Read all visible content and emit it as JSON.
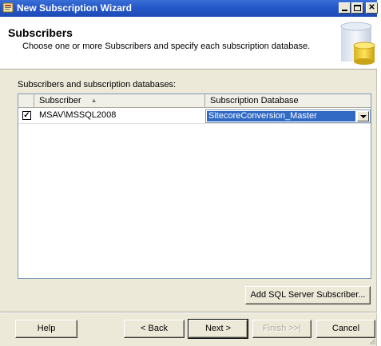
{
  "window": {
    "title": "New Subscription Wizard"
  },
  "header": {
    "title": "Subscribers",
    "subtitle": "Choose one or more Subscribers and specify each subscription database."
  },
  "section_label": "Subscribers and subscription databases:",
  "grid": {
    "columns": [
      "",
      "Subscriber",
      "Subscription Database"
    ],
    "rows": [
      {
        "checked": true,
        "check_glyph": "✓",
        "subscriber": "MSAV\\MSSQL2008",
        "database": "SitecoreConversion_Master"
      }
    ]
  },
  "buttons": {
    "add_subscriber": "Add SQL Server Subscriber...",
    "help": "Help",
    "back": "< Back",
    "next": "Next >",
    "finish": "Finish >>|",
    "cancel": "Cancel"
  },
  "icons": {
    "app": "wizard-app-icon",
    "header_graphic": "database-cylinder-icon",
    "sort": "sort-ascending-icon",
    "dropdown": "chevron-down-icon"
  },
  "colors": {
    "titlebar": "#2457c6",
    "selection": "#316ac5",
    "dialog_bg": "#ece9d8"
  }
}
